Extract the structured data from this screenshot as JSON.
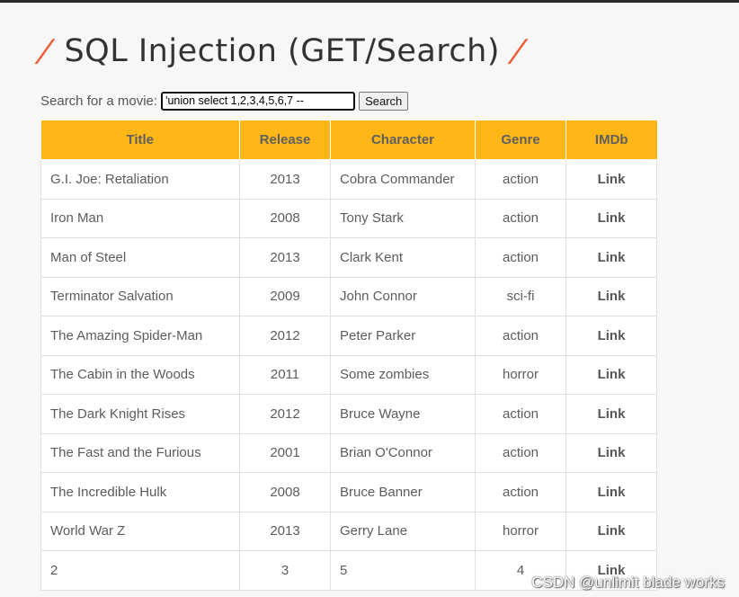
{
  "header": {
    "title": "SQL Injection (GET/Search)",
    "slash_left": "/",
    "slash_right": "/"
  },
  "search": {
    "label": "Search for a movie:",
    "value": "'union select 1,2,3,4,5,6,7 --",
    "button_label": "Search"
  },
  "table": {
    "columns": [
      "Title",
      "Release",
      "Character",
      "Genre",
      "IMDb"
    ],
    "rows": [
      {
        "title": "G.I. Joe: Retaliation",
        "release": "2013",
        "character": "Cobra Commander",
        "genre": "action",
        "imdb": "Link"
      },
      {
        "title": "Iron Man",
        "release": "2008",
        "character": "Tony Stark",
        "genre": "action",
        "imdb": "Link"
      },
      {
        "title": "Man of Steel",
        "release": "2013",
        "character": "Clark Kent",
        "genre": "action",
        "imdb": "Link"
      },
      {
        "title": "Terminator Salvation",
        "release": "2009",
        "character": "John Connor",
        "genre": "sci-fi",
        "imdb": "Link"
      },
      {
        "title": "The Amazing Spider-Man",
        "release": "2012",
        "character": "Peter Parker",
        "genre": "action",
        "imdb": "Link"
      },
      {
        "title": "The Cabin in the Woods",
        "release": "2011",
        "character": "Some zombies",
        "genre": "horror",
        "imdb": "Link"
      },
      {
        "title": "The Dark Knight Rises",
        "release": "2012",
        "character": "Bruce Wayne",
        "genre": "action",
        "imdb": "Link"
      },
      {
        "title": "The Fast and the Furious",
        "release": "2001",
        "character": "Brian O'Connor",
        "genre": "action",
        "imdb": "Link"
      },
      {
        "title": "The Incredible Hulk",
        "release": "2008",
        "character": "Bruce Banner",
        "genre": "action",
        "imdb": "Link"
      },
      {
        "title": "World War Z",
        "release": "2013",
        "character": "Gerry Lane",
        "genre": "horror",
        "imdb": "Link"
      },
      {
        "title": "2",
        "release": "3",
        "character": "5",
        "genre": "4",
        "imdb": "Link"
      }
    ]
  },
  "watermark": "CSDN @unlimit blade works",
  "colors": {
    "accent_orange": "#ffb717",
    "slash_red": "#ef5c34",
    "top_border": "#2b2b2b",
    "background": "#f7f7f7"
  }
}
